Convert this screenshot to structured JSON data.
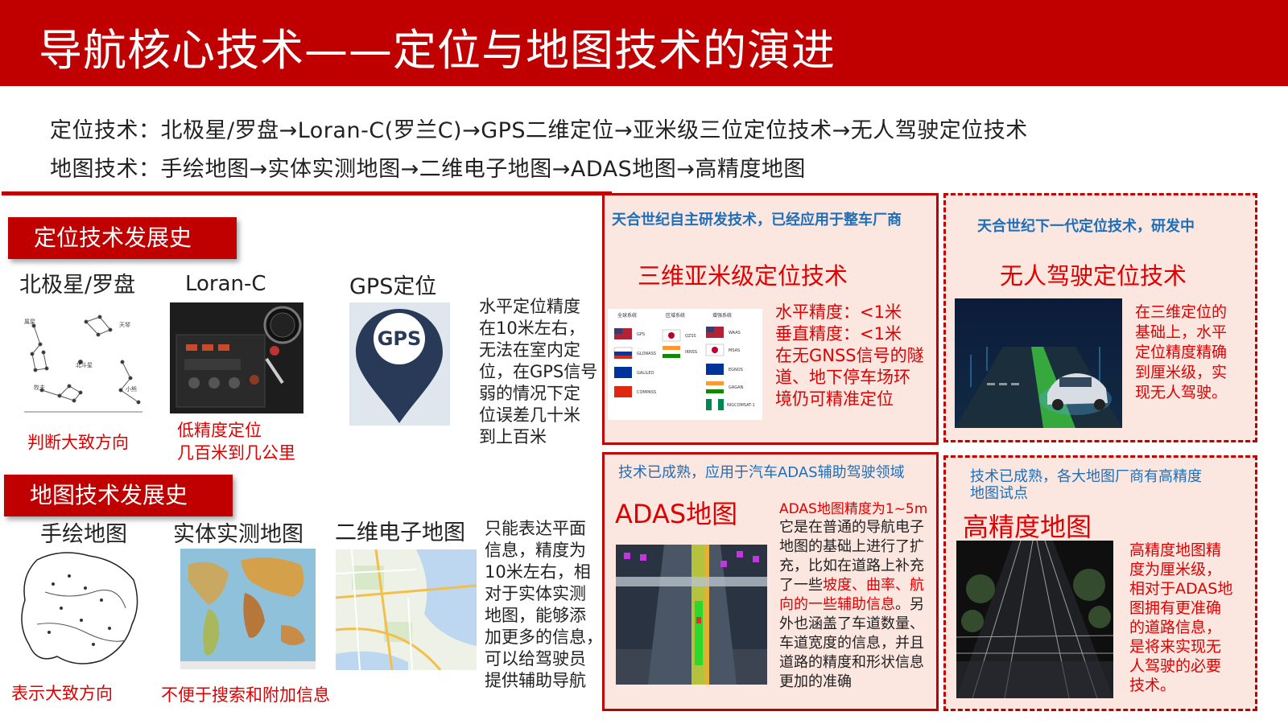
{
  "header": {
    "title": "导航核心技术——定位与地图技术的演进"
  },
  "intro": {
    "positioning": "定位技术：北极星/罗盘→Loran-C(罗兰C)→GPS二维定位→亚米级三位定位技术→无人驾驶定位技术",
    "map": "地图技术：手绘地图→实体实测地图→二维电子地图→ADAS地图→高精度地图"
  },
  "positioning_history": {
    "section_title": "定位技术发展史",
    "items": [
      {
        "title": "北极星/罗盘",
        "note": "判断大致方向"
      },
      {
        "title": "Loran-C",
        "note_lines": [
          "低精度定位",
          "几百米到几公里"
        ]
      },
      {
        "title": "GPS定位",
        "icon_text": "GPS"
      }
    ],
    "gps_desc_lines": [
      "水平定位精度",
      "在10米左右，",
      "无法在室内定",
      "位，在GPS信号",
      "弱的情况下定",
      "位误差几十米",
      "到上百米"
    ],
    "star_chart_labels": [
      "属星",
      "北斗星",
      "牧夫",
      "天琴",
      "小熊",
      "小熊"
    ]
  },
  "map_history": {
    "section_title": "地图技术发展史",
    "items": [
      {
        "title": "手绘地图",
        "note": "表示大致方向"
      },
      {
        "title": "实体实测地图",
        "note": "不便于搜索和附加信息"
      },
      {
        "title": "二维电子地图"
      }
    ],
    "emap_desc_lines": [
      "只能表达平面",
      "信息，精度为",
      "10米左右，相",
      "对于实体实测",
      "地图，能够添",
      "加更多的信息，",
      "可以给驾驶员",
      "提供辅助导航"
    ]
  },
  "panels": {
    "submeter": {
      "subtitle": "天合世纪自主研发技术，已经应用于整车厂商",
      "title": "三维亚米级定位技术",
      "desc_lines": [
        "水平精度：<1米",
        "垂直精度：<1米",
        "在无GNSS信号的隧",
        "道、地下停车场环",
        "境仍可精准定位"
      ],
      "table_headers": [
        "全球系统",
        "区域系统",
        "增强系统"
      ],
      "global_systems": [
        "GPS",
        "GLONASS",
        "GALILEO",
        "COMPASS"
      ],
      "regional_systems": [
        "QZSS",
        "IRNSS"
      ],
      "augmentation_systems": [
        "WAAS",
        "MSAS",
        "EGNOS",
        "GAGAN",
        "NIGCOMSAT-1"
      ]
    },
    "autonomous": {
      "subtitle": "天合世纪下一代定位技术，研发中",
      "title": "无人驾驶定位技术",
      "desc_lines": [
        "在三维定位的",
        "基础上，水平",
        "定位精度精确",
        "到厘米级，实",
        "现无人驾驶。"
      ]
    },
    "adas": {
      "subtitle": "技术已成熟，应用于汽车ADAS辅助驾驶领域",
      "title": "ADAS地图",
      "accuracy": "ADAS地图精度为1~5m",
      "desc_part1": "它是在普通的导航电子地图的基础上进行了扩充，比如在道路上补充了一些",
      "desc_red": "坡度、曲率、航向的一些辅助信息",
      "desc_part2": "。另外也涵盖了车道数量、车道宽度的信息，并且道路的精度和形状信息更加的准确"
    },
    "hd": {
      "subtitle_lines": [
        "技术已成熟，各大地图厂商有高精度",
        "地图试点"
      ],
      "title": "高精度地图",
      "desc_lines": [
        "高精度地图精",
        "度为厘米级，",
        "相对于ADAS地",
        "图拥有更准确",
        "的道路信息，",
        "是将来实现无",
        "人驾驶的必要",
        "技术。"
      ]
    }
  },
  "colors": {
    "brand_red": "#c00000",
    "note_red": "#e00000",
    "subtitle_blue": "#1e6fb8",
    "panel_bg": "#fbe6e0"
  }
}
